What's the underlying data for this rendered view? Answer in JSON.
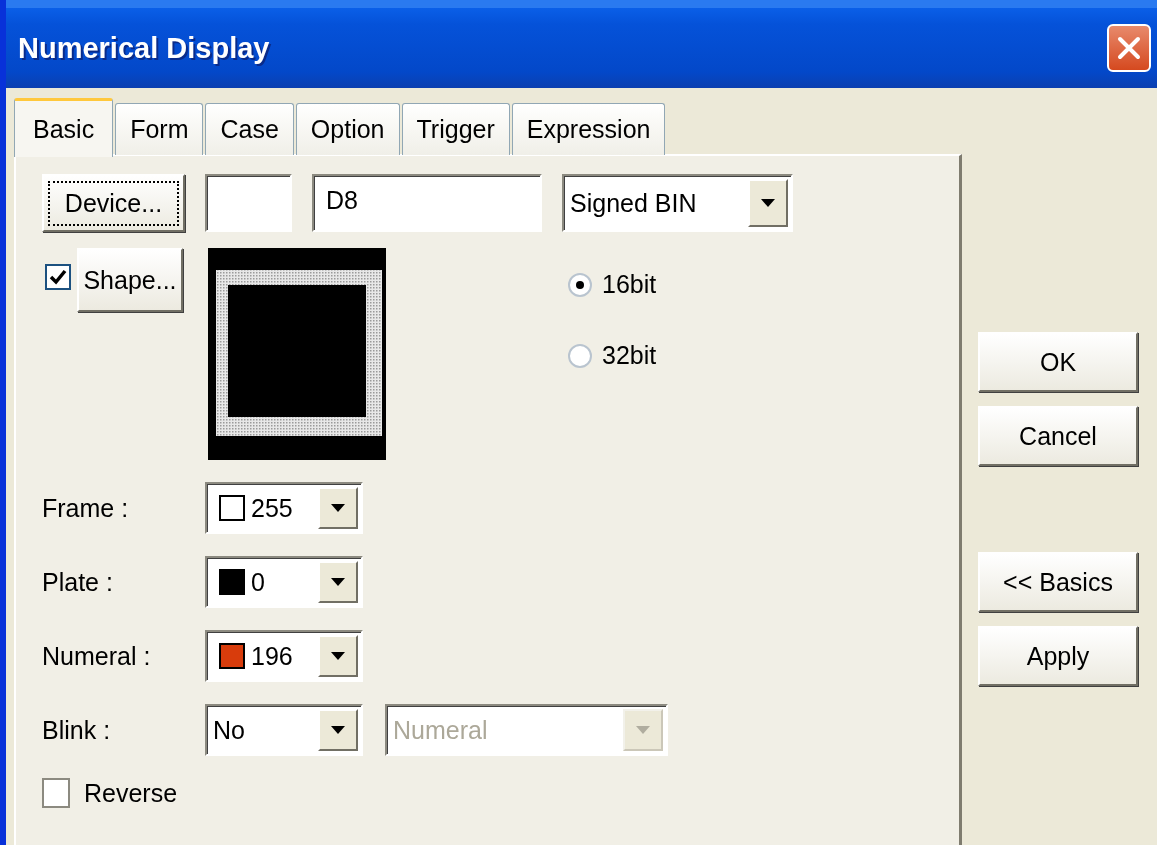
{
  "window": {
    "title": "Numerical Display"
  },
  "tabs": [
    {
      "label": "Basic",
      "selected": true
    },
    {
      "label": "Form",
      "selected": false
    },
    {
      "label": "Case",
      "selected": false
    },
    {
      "label": "Option",
      "selected": false
    },
    {
      "label": "Trigger",
      "selected": false
    },
    {
      "label": "Expression",
      "selected": false
    }
  ],
  "device": {
    "button": "Device...",
    "value": "D8",
    "format": "Signed BIN"
  },
  "shape": {
    "checked": true,
    "button": "Shape..."
  },
  "bit_options": [
    {
      "label": "16bit",
      "selected": true
    },
    {
      "label": "32bit",
      "selected": false
    }
  ],
  "colors": [
    {
      "label": "Frame :",
      "value": "255",
      "color": "#ffffff"
    },
    {
      "label": "Plate :",
      "value": "0",
      "color": "#000000"
    },
    {
      "label": "Numeral :",
      "value": "196",
      "color": "#d83c0c"
    }
  ],
  "blink": {
    "label": "Blink :",
    "value": "No",
    "target": "Numeral",
    "target_disabled": true
  },
  "reverse": {
    "label": "Reverse",
    "checked": false
  },
  "button_groups": [
    [
      "OK",
      "Cancel"
    ],
    [
      "<< Basics",
      "Apply"
    ]
  ]
}
